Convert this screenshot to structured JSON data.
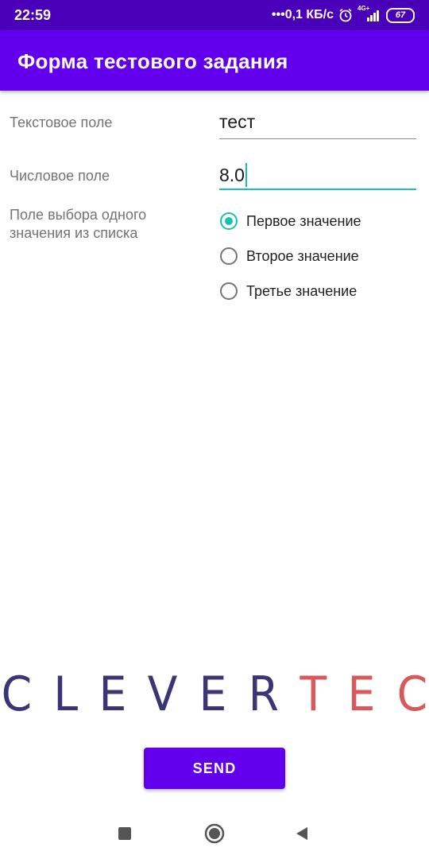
{
  "status_bar": {
    "time": "22:59",
    "net_speed": "•••0,1 КБ/с",
    "network_type": "4G+",
    "battery": "67"
  },
  "app_bar": {
    "title": "Форма тестового задания",
    "color": "#6200ee"
  },
  "form": {
    "text_field": {
      "label": "Текстовое поле",
      "value": "тест"
    },
    "number_field": {
      "label": "Числовое поле",
      "value": "8.0"
    },
    "radio_group": {
      "label": "Поле выбора одного значения из списка",
      "options": [
        {
          "label": "Первое значение",
          "checked": true
        },
        {
          "label": "Второе значение",
          "checked": false
        },
        {
          "label": "Третье значение",
          "checked": false
        }
      ]
    }
  },
  "logo": {
    "letters_part1": [
      "C",
      "L",
      "E",
      "V",
      "E",
      "R"
    ],
    "letters_part2": [
      "T",
      "E",
      "C"
    ],
    "color_part1": "#3b3576",
    "color_part2": "#d9585b"
  },
  "send_button": {
    "label": "SEND"
  },
  "nav_bar": {
    "icons": [
      "recents-square-icon",
      "home-circle-icon",
      "back-triangle-icon"
    ]
  },
  "accent_color": "#17c1b3"
}
